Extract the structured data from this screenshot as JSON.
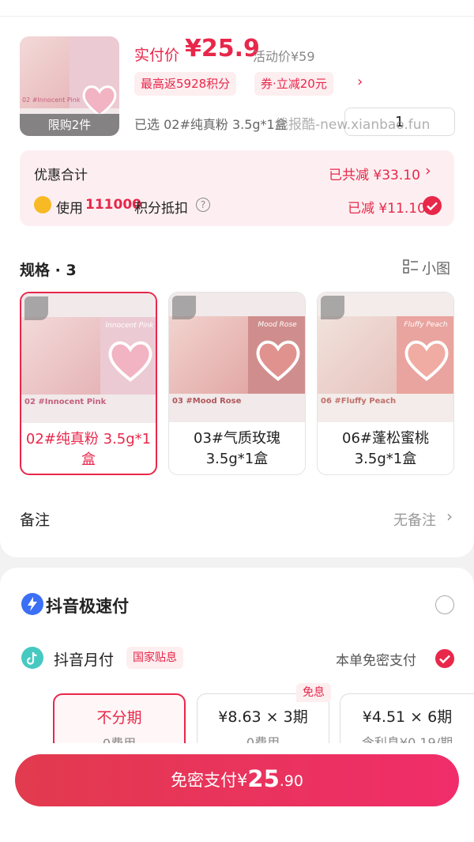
{
  "product": {
    "thumb_caption": "限购2件",
    "price_label": "实付价",
    "price": "¥25.9",
    "activity_price": "活动价¥59",
    "tag_points": "最高返5928积分",
    "tag_coupon": "券·立减20元",
    "selected_text": "已选 02#纯真粉 3.5g*1盒",
    "quantity": "1",
    "watermark": "线报酷-new.xianbao.fun"
  },
  "discount": {
    "title": "优惠合计",
    "total": "已共减 ¥33.10",
    "points_prefix": "使用",
    "points_value": "111000",
    "points_suffix": "积分抵扣",
    "points_reduce": "已减 ¥11.10"
  },
  "specs": {
    "title": "规格 · 3",
    "view_toggle": "小图",
    "items": [
      {
        "label": "02#纯真粉 3.5g*1盒",
        "img_title": "02 #Innocent Pink",
        "palette_name": "Innocent Pink",
        "selected": true
      },
      {
        "label": "03#气质玫瑰 3.5g*1盒",
        "img_title": "03 #Mood Rose",
        "palette_name": "Mood Rose",
        "selected": false
      },
      {
        "label": "06#蓬松蜜桃 3.5g*1盒",
        "img_title": "06 #Fluffy Peach",
        "palette_name": "Fluffy Peach",
        "selected": false
      }
    ]
  },
  "remark": {
    "label": "备注",
    "value": "无备注"
  },
  "payment": {
    "fast_pay": "抖音极速付",
    "monthly_pay": "抖音月付",
    "monthly_badge": "国家贴息",
    "monthly_status": "本单免密支付",
    "free_badge": "免息",
    "plans": [
      {
        "title": "不分期",
        "sub": "0费用"
      },
      {
        "title": "¥8.63 × 3期",
        "sub": "0费用"
      },
      {
        "title": "¥4.51 × 6期",
        "sub": "含利息¥0.19/期"
      }
    ]
  },
  "pay_button": {
    "prefix": "免密支付¥",
    "integer": "25",
    "decimal": ".90"
  },
  "colors": {
    "accent": "#e8274a"
  }
}
